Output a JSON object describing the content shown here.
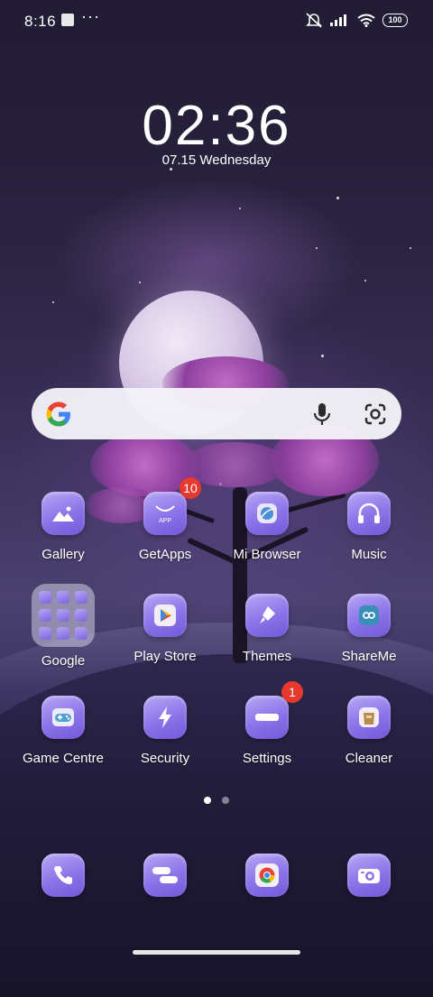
{
  "status_bar": {
    "time": "8:16",
    "more": "···",
    "battery": "100"
  },
  "lockscreen": {
    "clock": "02:36",
    "date": "07.15  Wednesday"
  },
  "search": {
    "icons": [
      "google-icon",
      "microphone-icon",
      "lens-icon"
    ]
  },
  "apps": {
    "row1": [
      {
        "label": "Gallery"
      },
      {
        "label": "GetApps",
        "badge": "10"
      },
      {
        "label": "Mi Browser"
      },
      {
        "label": "Music"
      }
    ],
    "row2": [
      {
        "label": "Google"
      },
      {
        "label": "Play Store"
      },
      {
        "label": "Themes"
      },
      {
        "label": "ShareMe"
      }
    ],
    "row3": [
      {
        "label": "Game Centre"
      },
      {
        "label": "Security"
      },
      {
        "label": "Settings",
        "badge": "1"
      },
      {
        "label": "Cleaner"
      }
    ]
  },
  "page_indicator": {
    "pages": 2,
    "active": 1
  },
  "dock": {
    "icons": [
      "phone-icon",
      "messages-icon",
      "chrome-icon",
      "camera-icon"
    ]
  },
  "colors": {
    "icon_gradient_start": "#b7a7f5",
    "icon_gradient_end": "#7358d8",
    "badge": "#e8392e"
  }
}
